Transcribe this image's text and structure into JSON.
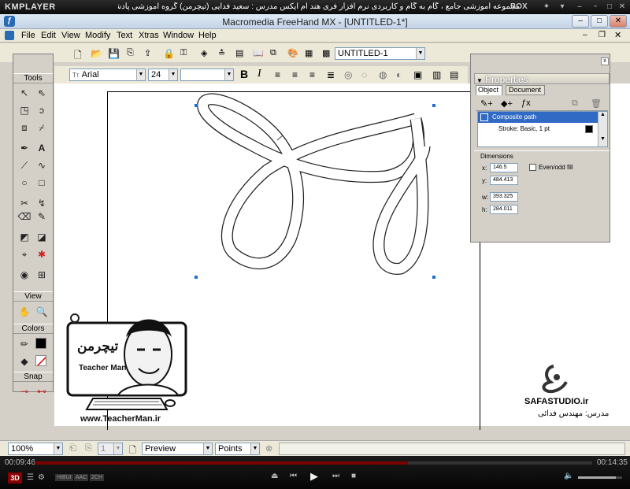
{
  "kmplayer": {
    "logo": "KMPLAYER",
    "caption": "مجموعه آموزشی جامع ، گام به گام و کاربردی نرم افزار فری هند ام ایکس   مدرس : سعید فدایی (تیچرمن) گروه آموزشی پادشاه گرافیست ها",
    "box_label": "BOX",
    "time_current": "00:09:46",
    "time_total": "00:14:35",
    "badge_3d": "3D",
    "tags": [
      "HIBUI",
      "AAC",
      "2CH"
    ],
    "progress_fraction": 0.67,
    "volume_fraction": 0.85
  },
  "window": {
    "title": "Macromedia FreeHand MX - [UNTITLED-1*]"
  },
  "menu": [
    "File",
    "Edit",
    "View",
    "Modify",
    "Text",
    "Xtras",
    "Window",
    "Help"
  ],
  "toolbar": {
    "document_select": "UNTITLED-1",
    "font_name": "Arial",
    "font_size": "24",
    "bold": "B",
    "italic": "I"
  },
  "tools_panel": {
    "title": "Tools",
    "view_header": "View",
    "colors_header": "Colors",
    "snap_header": "Snap"
  },
  "properties": {
    "title": "Properties",
    "tab_object": "Object",
    "tab_document": "Document",
    "item_selected": "Composite path",
    "item_stroke": "Stroke: Basic, 1 pt",
    "dimensions_label": "Dimensions",
    "x_label": "x:",
    "x_value": "146.5",
    "y_label": "y:",
    "y_value": "484.413",
    "w_label": "w:",
    "w_value": "393.325",
    "h_label": "h:",
    "h_value": "284.011",
    "evenodd_label": "Even/odd fill"
  },
  "status": {
    "zoom": "100%",
    "page": "1",
    "view_mode": "Preview",
    "units": "Points"
  },
  "watermark": {
    "teacher_logo_text": "تیچرمن",
    "teacher_name": "Teacher Man",
    "teacher_url": "www.TeacherMan.ir",
    "studio": "SAFASTUDIO.ir",
    "instructor": "مدرس: مهندس فدائی"
  }
}
